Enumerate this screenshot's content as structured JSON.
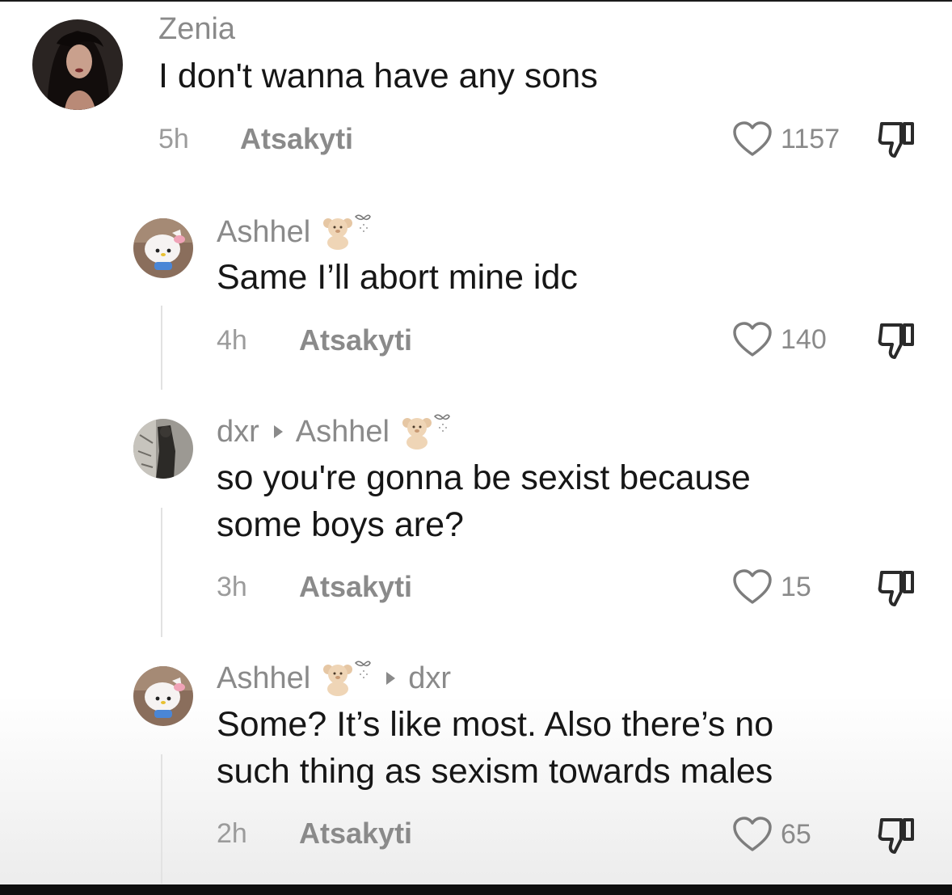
{
  "comments": [
    {
      "username": "Zenia",
      "reply_to": "",
      "text_lines": [
        "I don't wanna have any sons"
      ],
      "time": "5h",
      "author": "Atsakyti",
      "likes": "1157"
    },
    {
      "username": "Ashhel",
      "reply_to": "",
      "text_lines": [
        "Same I’ll abort mine idc"
      ],
      "time": "4h",
      "author": "Atsakyti",
      "likes": "140"
    },
    {
      "username": "dxr",
      "reply_to": "Ashhel",
      "text_lines": [
        "so you're gonna be sexist because",
        "some boys are?"
      ],
      "time": "3h",
      "author": "Atsakyti",
      "likes": "15"
    },
    {
      "username": "Ashhel",
      "reply_to": "dxr",
      "text_lines": [
        "Some? It’s like most. Also there’s no",
        "such thing as sexism towards males"
      ],
      "time": "2h",
      "author": "Atsakyti",
      "likes": "65"
    }
  ],
  "icons": {
    "like": "heart-outline-icon",
    "dislike": "thumbs-down-icon",
    "badge": "teddy-bear-bow-emoji"
  },
  "colors": {
    "text_primary": "#161616",
    "text_secondary": "#8a8a8a",
    "background": "#ffffff"
  }
}
